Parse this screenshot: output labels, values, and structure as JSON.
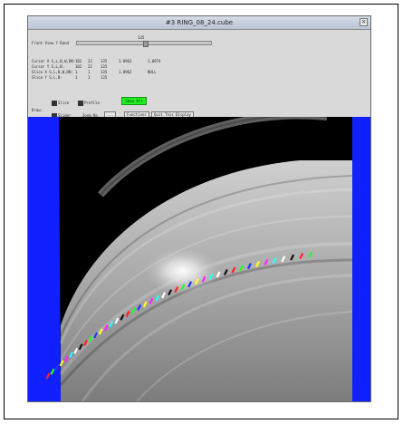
{
  "window": {
    "title": "#3 RING_08_24.cube",
    "close": "×"
  },
  "controls": {
    "band_label": "Front View Y Band",
    "band_value": "135",
    "rows": [
      [
        "Cursor X S,L,B,W,DN:",
        "102",
        "22",
        "135",
        "1.0962",
        "1.0974"
      ],
      [
        "Cursor Y S,L,B:",
        "102",
        "22",
        "135",
        "",
        ""
      ],
      [
        "Slice X S,L,B,W,DN:",
        "1",
        "1",
        "135",
        "1.0962",
        "NULL"
      ],
      [
        "Slice Y S,L,B:",
        "1",
        "1",
        "135",
        "",
        ""
      ]
    ],
    "row1_checks": {
      "slice": "Slice",
      "profile": "Profile"
    },
    "green_button": "Show All",
    "draw_label": "Draw:",
    "slider_check": "Slider",
    "zoom_label": "Zoom No",
    "zoom_btn": "...",
    "functions_btn": "Functions",
    "quit_btn": "Quit This Display"
  },
  "colors": {
    "background_blue": "#1020ff",
    "accent_green": "#22ee22",
    "marker_palette": [
      "#ff2222",
      "#22ff22",
      "#2233ff",
      "#ffff22",
      "#ff22ff",
      "#22ffff",
      "#ffffff",
      "#111111"
    ]
  }
}
